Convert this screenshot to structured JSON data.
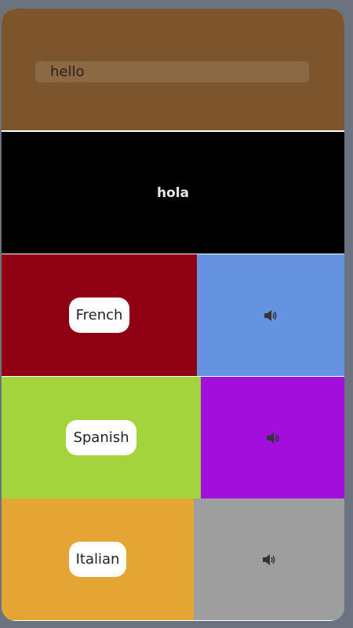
{
  "search": {
    "value": "hello"
  },
  "translation": {
    "text": "hola"
  },
  "languages": [
    {
      "label": "French",
      "bg": "#8f0012",
      "sound_bg": "#6693e0",
      "sound_icon": "speaker-icon"
    },
    {
      "label": "Spanish",
      "bg": "#a3d43c",
      "sound_bg": "#a20fdc",
      "sound_icon": "speaker-icon"
    },
    {
      "label": "Italian",
      "bg": "#e3a633",
      "sound_bg": "#9e9e9e",
      "sound_icon": "speaker-icon"
    }
  ],
  "colors": {
    "header_bg": "#7d552c",
    "translation_bg": "#000000",
    "frame": "#6b7280"
  }
}
